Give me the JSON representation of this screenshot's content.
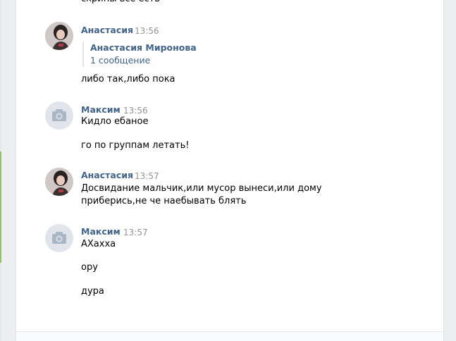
{
  "messages": [
    {
      "text": "скрины все есть"
    },
    {
      "author": "Анастасия",
      "time": "13:56",
      "forward": {
        "author": "Анастасия Миронова",
        "count": "1 сообщение"
      },
      "lines": [
        "либо так,либо пока"
      ]
    },
    {
      "author": "Максим",
      "time": "13:56",
      "lines": [
        "Кидло ебаное",
        "го по группам летать!"
      ]
    },
    {
      "author": "Анастасия",
      "time": "13:57",
      "lines": [
        "Досвидание мальчик,или мусор вынеси,или дому приберись,не че наебывать блять"
      ]
    },
    {
      "author": "Максим",
      "time": "13:57",
      "lines": [
        "АХахха",
        "ору",
        "дура"
      ]
    }
  ],
  "icons": {
    "user_photo": "user-photo-avatar",
    "camera": "camera-icon"
  },
  "colors": {
    "name": "#42648b",
    "time": "#939393",
    "background": "#edeef0"
  }
}
